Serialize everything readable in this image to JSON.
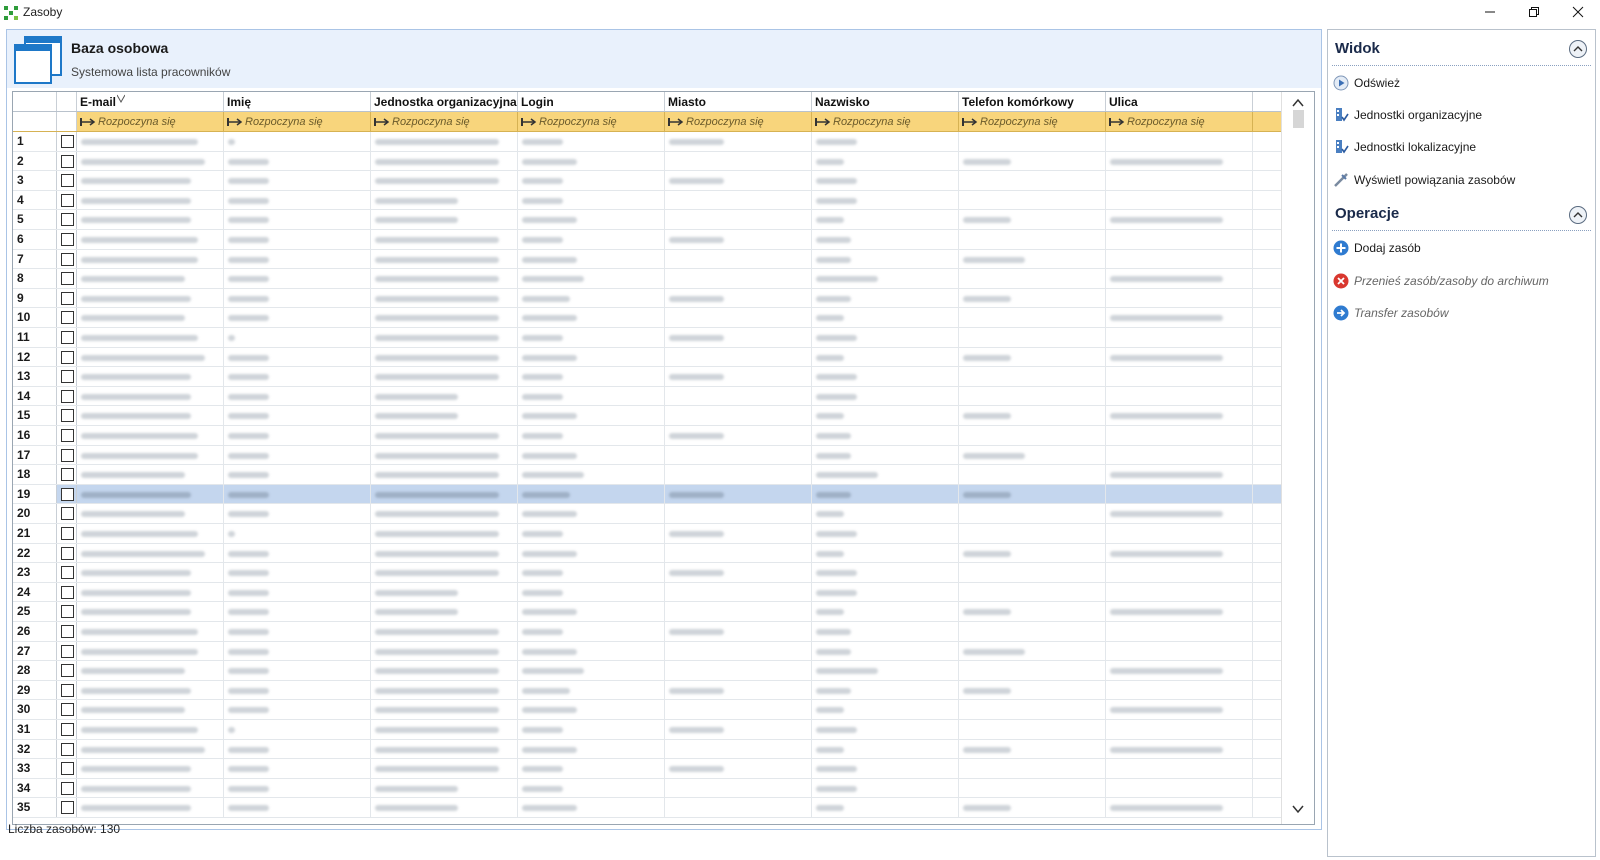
{
  "window": {
    "title": "Zasoby"
  },
  "header": {
    "title": "Baza osobowa",
    "subtitle": "Systemowa lista pracowników"
  },
  "grid": {
    "columns": [
      {
        "label": "E-mail",
        "filter": "Rozpoczyna się"
      },
      {
        "label": "Imię",
        "filter": "Rozpoczyna się"
      },
      {
        "label": "Jednostka organizacyjna",
        "filter": "Rozpoczyna się"
      },
      {
        "label": "Login",
        "filter": "Rozpoczyna się"
      },
      {
        "label": "Miasto",
        "filter": "Rozpoczyna się"
      },
      {
        "label": "Nazwisko",
        "filter": "Rozpoczyna się"
      },
      {
        "label": "Telefon komórkowy",
        "filter": "Rozpoczyna się"
      },
      {
        "label": "Ulica",
        "filter": "Rozpoczyna się"
      }
    ],
    "row_numbers": [
      "1",
      "2",
      "3",
      "4",
      "5",
      "6",
      "7",
      "8",
      "9",
      "10",
      "11",
      "12",
      "13",
      "14",
      "15",
      "16",
      "17",
      "18",
      "19",
      "20",
      "21",
      "22",
      "23",
      "24",
      "25",
      "26",
      "27",
      "28",
      "29",
      "30",
      "31",
      "32",
      "33",
      "34",
      "35"
    ],
    "selected_row": 19
  },
  "status": {
    "text": "Liczba zasobów: 130"
  },
  "side": {
    "view": {
      "title": "Widok",
      "items": [
        {
          "label": "Odśwież",
          "icon": "refresh-icon"
        },
        {
          "label": "Jednostki organizacyjne",
          "icon": "org-units-icon"
        },
        {
          "label": "Jednostki lokalizacyjne",
          "icon": "location-units-icon"
        },
        {
          "label": "Wyświetl powiązania zasobów",
          "icon": "link-icon"
        }
      ]
    },
    "operations": {
      "title": "Operacje",
      "items": [
        {
          "label": "Dodaj zasób",
          "icon": "add-icon",
          "enabled": true
        },
        {
          "label": "Przenieś zasób/zasoby do archiwum",
          "icon": "archive-icon",
          "enabled": false
        },
        {
          "label": "Transfer zasobów",
          "icon": "transfer-icon",
          "enabled": false
        }
      ]
    }
  },
  "colors": {
    "accent": "#4a7fc1",
    "filter_row": "#f8d57c",
    "selected_row": "#c4d6ee",
    "header_bg": "#e9f1fc"
  }
}
